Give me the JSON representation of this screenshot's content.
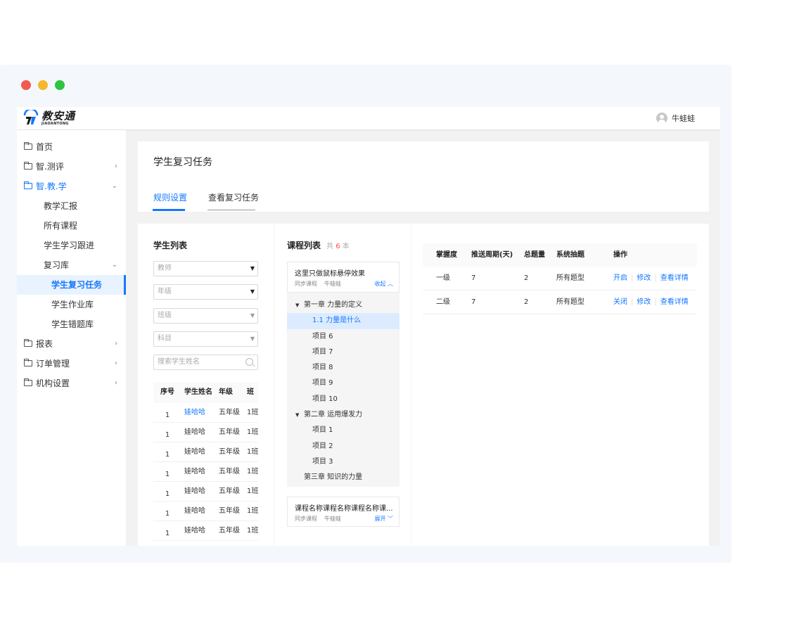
{
  "app": {
    "logo_name": "教安通",
    "logo_sub": "JIAOANTONG",
    "user_name": "牛蛙蛙"
  },
  "sidebar": {
    "items": [
      {
        "label": "首页"
      },
      {
        "label": "智.测评"
      },
      {
        "label": "智.教.学"
      },
      {
        "label": "教学汇报"
      },
      {
        "label": "所有课程"
      },
      {
        "label": "学生学习跟进"
      },
      {
        "label": "复习库"
      },
      {
        "label": "学生复习任务"
      },
      {
        "label": "学生作业库"
      },
      {
        "label": "学生错题库"
      },
      {
        "label": "报表"
      },
      {
        "label": "订单管理"
      },
      {
        "label": "机构设置"
      }
    ]
  },
  "page": {
    "title": "学生复习任务",
    "tabs": [
      {
        "label": "规则设置"
      },
      {
        "label": "查看复习任务"
      }
    ]
  },
  "student_panel": {
    "title": "学生列表",
    "filters": {
      "teacher": "教师",
      "grade": "年级",
      "class": "班级",
      "subject": "科目",
      "search_placeholder": "搜索学生姓名"
    },
    "columns": [
      "序号",
      "学生姓名",
      "年级",
      "班"
    ],
    "rows": [
      {
        "no": "1",
        "name": "娃哈哈",
        "grade": "五年级",
        "cls": "1班"
      },
      {
        "no": "1",
        "name": "娃哈哈",
        "grade": "五年级",
        "cls": "1班"
      },
      {
        "no": "1",
        "name": "娃哈哈",
        "grade": "五年级",
        "cls": "1班"
      },
      {
        "no": "1",
        "name": "娃哈哈",
        "grade": "五年级",
        "cls": "1班"
      },
      {
        "no": "1",
        "name": "娃哈哈",
        "grade": "五年级",
        "cls": "1班"
      },
      {
        "no": "1",
        "name": "娃哈哈",
        "grade": "五年级",
        "cls": "1班"
      },
      {
        "no": "1",
        "name": "娃哈哈",
        "grade": "五年级",
        "cls": "1班"
      }
    ]
  },
  "course_panel": {
    "title": "课程列表",
    "count_prefix": "共",
    "count": "6",
    "count_suffix": "本",
    "card1": {
      "title": "这里只做鼠标悬停效果",
      "type": "同步课程",
      "author": "牛蛙蛙",
      "toggle": "收起"
    },
    "tree": {
      "chapter1": "第一章 力量的定义",
      "c1_items": [
        "1.1 力量是什么",
        "项目 6",
        "项目 7",
        "项目 8",
        "项目 9",
        "项目 10"
      ],
      "chapter2": "第二章 运用爆发力",
      "c2_items": [
        "项目 1",
        "项目 2",
        "项目 3"
      ],
      "chapter3": "第三章 知识的力量"
    },
    "card2": {
      "title": "课程名称课程名称课程名称课...",
      "type": "同步课程",
      "author": "牛蛙蛙",
      "toggle": "展开"
    }
  },
  "rules_panel": {
    "columns": [
      "掌握度",
      "推送周期(天)",
      "总题量",
      "系统抽题",
      "操作"
    ],
    "rows": [
      {
        "level": "一级",
        "cycle": "7",
        "total": "2",
        "draw": "所有题型",
        "toggle": "开启",
        "edit": "修改",
        "detail": "查看详情"
      },
      {
        "level": "二级",
        "cycle": "7",
        "total": "2",
        "draw": "所有题型",
        "toggle": "关闭",
        "edit": "修改",
        "detail": "查看详情"
      }
    ]
  },
  "colors": {
    "accent": "#1677ff",
    "count_red": "#ff4d4f"
  }
}
